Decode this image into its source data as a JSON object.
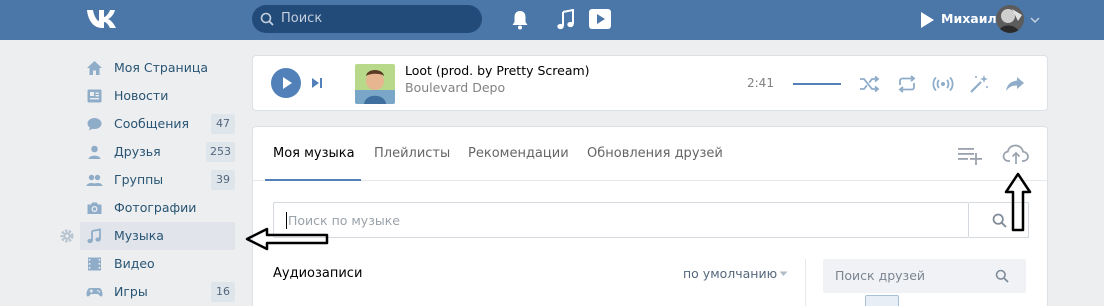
{
  "header": {
    "search_placeholder": "Поиск",
    "user_name": "Михаил"
  },
  "sidebar": {
    "items": [
      {
        "label": "Моя Страница",
        "icon": "home-icon",
        "count": ""
      },
      {
        "label": "Новости",
        "icon": "news-icon",
        "count": ""
      },
      {
        "label": "Сообщения",
        "icon": "messages-icon",
        "count": "47"
      },
      {
        "label": "Друзья",
        "icon": "friends-icon",
        "count": "253"
      },
      {
        "label": "Группы",
        "icon": "groups-icon",
        "count": "39"
      },
      {
        "label": "Фотографии",
        "icon": "camera-icon",
        "count": ""
      },
      {
        "label": "Музыка",
        "icon": "music-icon",
        "count": ""
      },
      {
        "label": "Видео",
        "icon": "video-icon",
        "count": ""
      },
      {
        "label": "Игры",
        "icon": "gamepad-icon",
        "count": "16"
      }
    ]
  },
  "player": {
    "title": "Loot (prod. by Pretty Scream)",
    "artist": "Boulevard Depo",
    "time": "2:41"
  },
  "music": {
    "tabs": [
      {
        "label": "Моя музыка"
      },
      {
        "label": "Плейлисты"
      },
      {
        "label": "Рекомендации"
      },
      {
        "label": "Обновления друзей"
      }
    ],
    "search_placeholder": "Поиск по музыке",
    "audio_heading": "Аудиозаписи",
    "sort_label": "по умолчанию",
    "friends_search_placeholder": "Поиск друзей"
  },
  "colors": {
    "header_bg": "#4a76a8",
    "accent": "#5181b8",
    "page_bg": "#edeef0"
  }
}
